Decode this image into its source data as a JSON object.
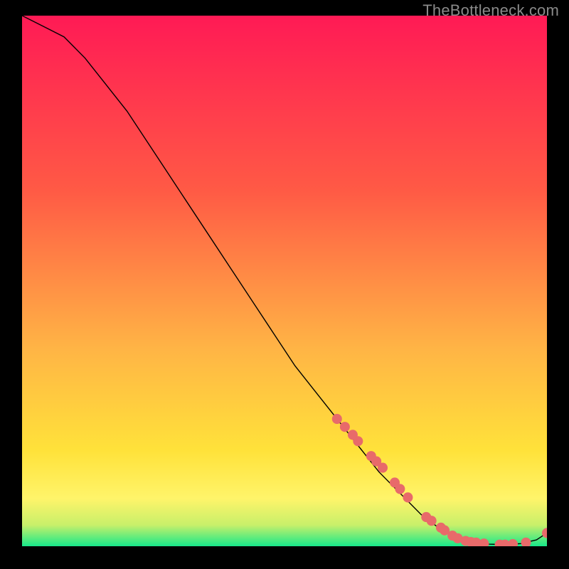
{
  "watermark": "TheBottleneck.com",
  "colors": {
    "gradient_top": "#ff1a55",
    "gradient_mid1": "#ff7a3a",
    "gradient_mid2": "#ffe23a",
    "gradient_bottom_yellow": "#fff46a",
    "gradient_green": "#17e88a",
    "curve": "#000000",
    "dot": "#e86a6a",
    "background": "#000000",
    "watermark_text": "#8a8a8a"
  },
  "chart_data": {
    "type": "line",
    "title": "",
    "xlabel": "",
    "ylabel": "",
    "xlim": [
      0,
      100
    ],
    "ylim": [
      0,
      100
    ],
    "series": [
      {
        "name": "curve",
        "x": [
          0,
          4,
          8,
          12,
          16,
          20,
          24,
          28,
          32,
          36,
          40,
          44,
          48,
          52,
          56,
          60,
          64,
          68,
          72,
          76,
          80,
          83,
          86,
          89,
          92,
          95,
          98,
          100
        ],
        "y": [
          100,
          98,
          96,
          92,
          87,
          82,
          76,
          70,
          64,
          58,
          52,
          46,
          40,
          34,
          29,
          24,
          19,
          14,
          10,
          6,
          3,
          1.5,
          0.8,
          0.4,
          0.3,
          0.5,
          1.2,
          2.5
        ]
      }
    ],
    "markers": {
      "name": "dots",
      "x": [
        60,
        61.5,
        63,
        64,
        66.5,
        67.5,
        68.7,
        71,
        72,
        73.5,
        77,
        78,
        79.8,
        80.5,
        82,
        83,
        84.5,
        85.5,
        86.5,
        88,
        91,
        92,
        93.5,
        96,
        100
      ],
      "y": [
        24,
        22.5,
        21,
        19.8,
        17,
        16,
        14.8,
        12,
        10.8,
        9.2,
        5.5,
        4.8,
        3.5,
        3,
        2,
        1.5,
        1,
        0.8,
        0.7,
        0.5,
        0.3,
        0.3,
        0.4,
        0.7,
        2.5
      ]
    }
  }
}
